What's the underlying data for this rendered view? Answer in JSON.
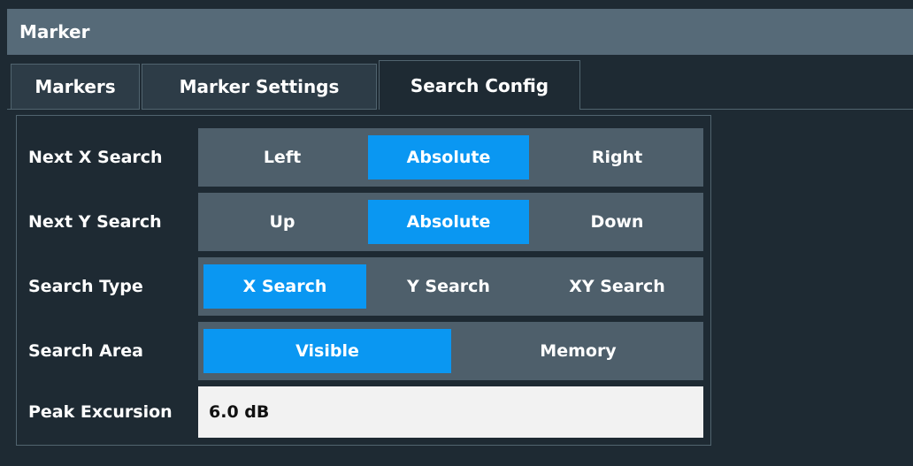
{
  "window": {
    "title": "Marker"
  },
  "tabs": [
    {
      "label": "Markers",
      "active": false
    },
    {
      "label": "Marker Settings",
      "active": false
    },
    {
      "label": "Search Config",
      "active": true
    }
  ],
  "settings": {
    "next_x_search": {
      "label": "Next X Search",
      "options": [
        "Left",
        "Absolute",
        "Right"
      ],
      "selected": "Absolute"
    },
    "next_y_search": {
      "label": "Next Y Search",
      "options": [
        "Up",
        "Absolute",
        "Down"
      ],
      "selected": "Absolute"
    },
    "search_type": {
      "label": "Search Type",
      "options": [
        "X Search",
        "Y Search",
        "XY Search"
      ],
      "selected": "X Search"
    },
    "search_area": {
      "label": "Search Area",
      "options": [
        "Visible",
        "Memory"
      ],
      "selected": "Visible"
    },
    "peak_excursion": {
      "label": "Peak Excursion",
      "value": "6.0 dB"
    }
  },
  "colors": {
    "background": "#1e2a33",
    "titlebar": "#566a78",
    "segment_bg": "#4e5f6b",
    "selected": "#0a97f2",
    "field_bg": "#f2f2f2"
  }
}
